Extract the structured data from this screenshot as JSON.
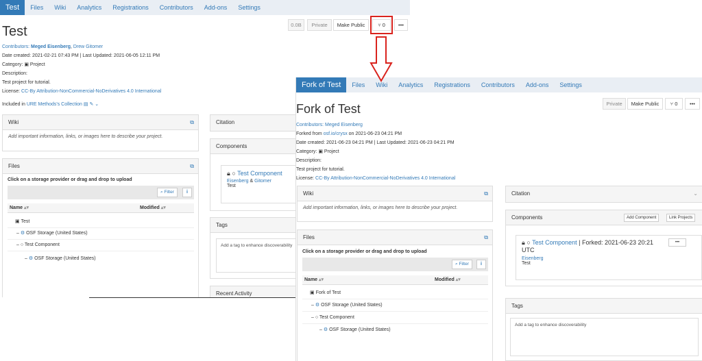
{
  "screen1": {
    "nav": [
      "Test",
      "Files",
      "Wiki",
      "Analytics",
      "Registrations",
      "Contributors",
      "Add-ons",
      "Settings"
    ],
    "buttons": {
      "size": "0.0B",
      "privacy": "Private",
      "make_public": "Make Public",
      "fork_count": "0",
      "more": "•••"
    },
    "title": "Test",
    "contributors_label": "Contributors:",
    "contributor_1": "Meged Eisenberg",
    "contributor_2": "Drew Gitomer",
    "dates": "Date created: 2021-02-21 07:43 PM | Last Updated: 2021-06-05 12:11 PM",
    "category_label": "Category:",
    "category_value": "Project",
    "description_label": "Description:",
    "description_value": "Test project for tutorial.",
    "license_label": "License:",
    "license_value": "CC-By Attribution-NonCommercial-NoDerivatives 4.0 International",
    "included_label": "Included in",
    "collection": "URE Methods's Collection",
    "wiki_title": "Wiki",
    "wiki_placeholder": "Add important information, links, or images here to describe your project.",
    "files_title": "Files",
    "files_instr": "Click on a storage provider or drag and drop to upload",
    "filter": "Filter",
    "col_name": "Name",
    "col_modified": "Modified",
    "tree": [
      "Test",
      "OSF Storage (United States)",
      "Test Component",
      "OSF Storage (United States)"
    ],
    "citation": "Citation",
    "components": "Components",
    "component_name": "Test Component",
    "component_contrib_1": "Eisenberg",
    "component_contrib_2": "Gitomer",
    "component_parent": "Test",
    "tags": "Tags",
    "tags_placeholder": "Add a tag to enhance discoverability",
    "recent_activity": "Recent Activity"
  },
  "screen2": {
    "nav": [
      "Fork of Test",
      "Files",
      "Wiki",
      "Analytics",
      "Registrations",
      "Contributors",
      "Add-ons",
      "Settings"
    ],
    "buttons": {
      "privacy": "Private",
      "make_public": "Make Public",
      "fork_count": "0",
      "more": "•••"
    },
    "title": "Fork of Test",
    "contributors_label": "Contributors:",
    "contributor_1": "Meged Eisenberg",
    "forked_from_label": "Forked from",
    "forked_from_link": "osf.io/crysx",
    "forked_from_date": "on 2021-06-23 04:21 PM",
    "dates": "Date created: 2021-06-23 04:21 PM | Last Updated: 2021-06-23 04:21 PM",
    "category_label": "Category:",
    "category_value": "Project",
    "description_label": "Description:",
    "description_value": "Test project for tutorial.",
    "license_label": "License:",
    "license_value": "CC-By Attribution-NonCommercial-NoDerivatives 4.0 International",
    "wiki_title": "Wiki",
    "wiki_placeholder": "Add important information, links, or images here to describe your project.",
    "files_title": "Files",
    "files_instr": "Click on a storage provider or drag and drop to upload",
    "filter": "Filter",
    "col_name": "Name",
    "col_modified": "Modified",
    "tree": [
      "Fork of Test",
      "OSF Storage (United States)",
      "Test Component",
      "OSF Storage (United States)"
    ],
    "citation": "Citation",
    "components": "Components",
    "add_component": "Add Component",
    "link_projects": "Link Projects",
    "component_name": "Test Component",
    "component_forked": "| Forked: 2021-06-23 20:21",
    "component_utc": "UTC",
    "component_contrib": "Eisenberg",
    "component_parent": "Test",
    "tags": "Tags",
    "tags_placeholder": "Add a tag to enhance discoverability"
  },
  "colors": {
    "accent": "#337ab7",
    "highlight": "#d9231d",
    "nav_bg": "#e9eef4"
  }
}
